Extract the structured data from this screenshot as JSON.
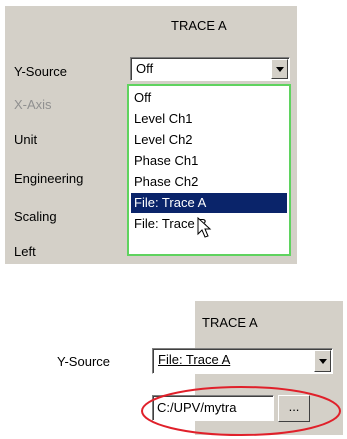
{
  "panel_top": {
    "header": "TRACE A",
    "y_source_label": "Y-Source",
    "y_source_value": "Off",
    "rows": [
      "X-Axis",
      "Unit",
      "Engineering",
      "Scaling",
      "Left"
    ],
    "dropdown_options": [
      "Off",
      "Level Ch1",
      "Level Ch2",
      "Phase Ch1",
      "Phase Ch2",
      "File: Trace A",
      "File: Trace B"
    ],
    "selected_option": "File: Trace A"
  },
  "panel_bottom": {
    "header": "TRACE A",
    "y_source_label": "Y-Source",
    "y_source_value": "File: Trace A",
    "file_path": "C:/UPV/mytra",
    "browse_label": "..."
  },
  "colors": {
    "panel_bg": "#d4d0c8",
    "list_border": "#5fd35f",
    "selection_bg": "#0a246a",
    "highlight_ellipse": "#e0202a"
  },
  "icons": [
    "dropdown-arrow-icon",
    "mouse-cursor-icon"
  ]
}
